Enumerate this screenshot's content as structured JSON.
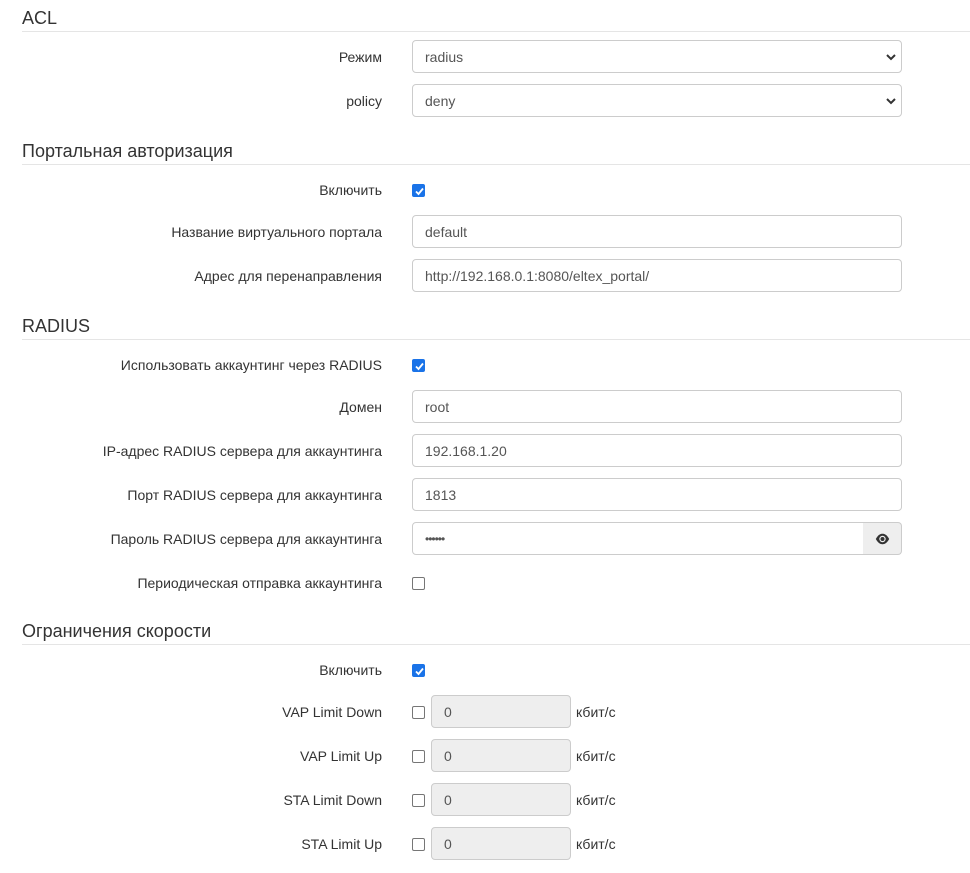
{
  "acl": {
    "title": "ACL",
    "mode_label": "Режим",
    "mode_value": "radius",
    "policy_label": "policy",
    "policy_value": "deny"
  },
  "portal": {
    "title": "Портальная авторизация",
    "enable_label": "Включить",
    "enable_checked": true,
    "name_label": "Название виртуального портала",
    "name_value": "default",
    "redirect_label": "Адрес для перенаправления",
    "redirect_value": "http://192.168.0.1:8080/eltex_portal/"
  },
  "radius": {
    "title": "RADIUS",
    "accounting_label": "Использовать аккаунтинг через RADIUS",
    "accounting_checked": true,
    "domain_label": "Домен",
    "domain_value": "root",
    "ip_label": "IP-адрес RADIUS сервера для аккаунтинга",
    "ip_value": "192.168.1.20",
    "port_label": "Порт RADIUS сервера для аккаунтинга",
    "port_value": "1813",
    "password_label": "Пароль RADIUS сервера для аккаунтинга",
    "password_value": "••••••",
    "show_password_icon": "eye-icon",
    "periodic_label": "Периодическая отправка аккаунтинга",
    "periodic_checked": false
  },
  "speed": {
    "title": "Ограничения скорости",
    "enable_label": "Включить",
    "enable_checked": true,
    "unit": "кбит/с",
    "limits": [
      {
        "label": "VAP Limit Down",
        "value": "0",
        "checked": false
      },
      {
        "label": "VAP Limit Up",
        "value": "0",
        "checked": false
      },
      {
        "label": "STA Limit Down",
        "value": "0",
        "checked": false
      },
      {
        "label": "STA Limit Up",
        "value": "0",
        "checked": false
      }
    ]
  },
  "colors": {
    "checkbox_checked": "#1a73e8",
    "border": "#cccccc",
    "disabled_bg": "#eeeeee",
    "text": "#333333"
  }
}
